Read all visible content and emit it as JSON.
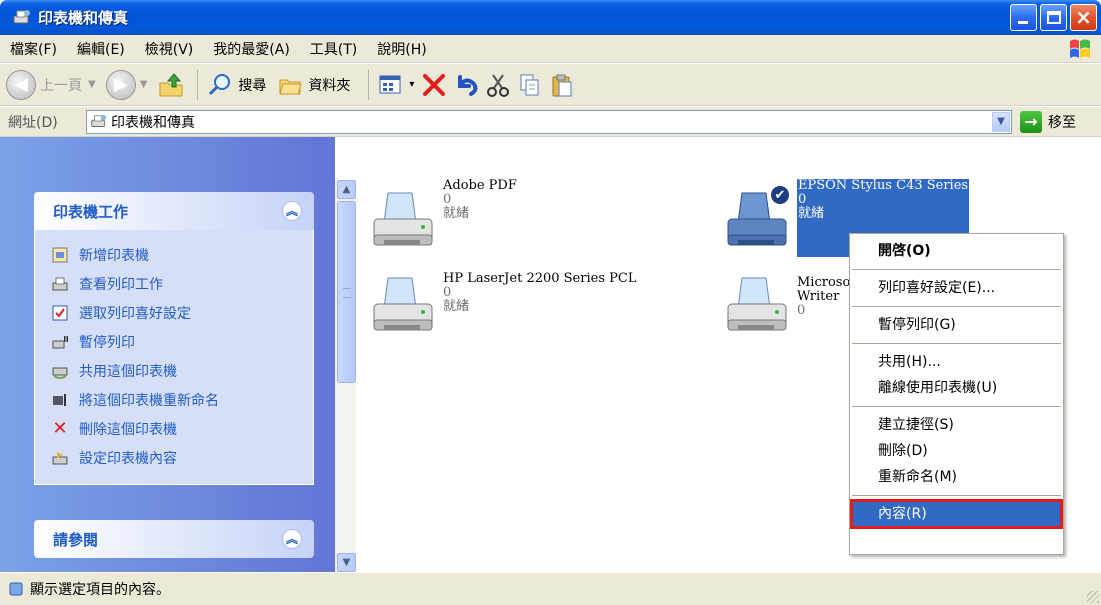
{
  "window": {
    "title": "印表機和傳真"
  },
  "menu": {
    "items": [
      "檔案(F)",
      "編輯(E)",
      "檢視(V)",
      "我的最愛(A)",
      "工具(T)",
      "說明(H)"
    ]
  },
  "toolbar": {
    "back": "上一頁",
    "search": "搜尋",
    "folders": "資料夾"
  },
  "address": {
    "label": "網址(D)",
    "value": "印表機和傳真",
    "go": "移至"
  },
  "left_pane": {
    "printer_tasks": {
      "title": "印表機工作",
      "items": [
        "新增印表機",
        "查看列印工作",
        "選取列印喜好設定",
        "暫停列印",
        "共用這個印表機",
        "將這個印表機重新命名",
        "刪除這個印表機",
        "設定印表機內容"
      ]
    },
    "see_also": {
      "title": "請參閱"
    }
  },
  "printers": [
    {
      "name": "Adobe PDF",
      "docs": "0",
      "status": "就緒"
    },
    {
      "name": "EPSON Stylus C43 Series",
      "docs": "0",
      "status": "就緒"
    },
    {
      "name": "HP LaserJet 2200 Series PCL",
      "docs": "0",
      "status": "就緒"
    },
    {
      "name": "Microso",
      "name2": "Writer",
      "docs": "0"
    }
  ],
  "context_menu": {
    "open": "開啓(O)",
    "printing_prefs": "列印喜好設定(E)...",
    "pause": "暫停列印(G)",
    "sharing": "共用(H)...",
    "use_offline": "離線使用印表機(U)",
    "create_shortcut": "建立捷徑(S)",
    "delete": "刪除(D)",
    "rename": "重新命名(M)",
    "properties": "內容(R)"
  },
  "status_bar": {
    "text": "顯示選定項目的內容。"
  }
}
